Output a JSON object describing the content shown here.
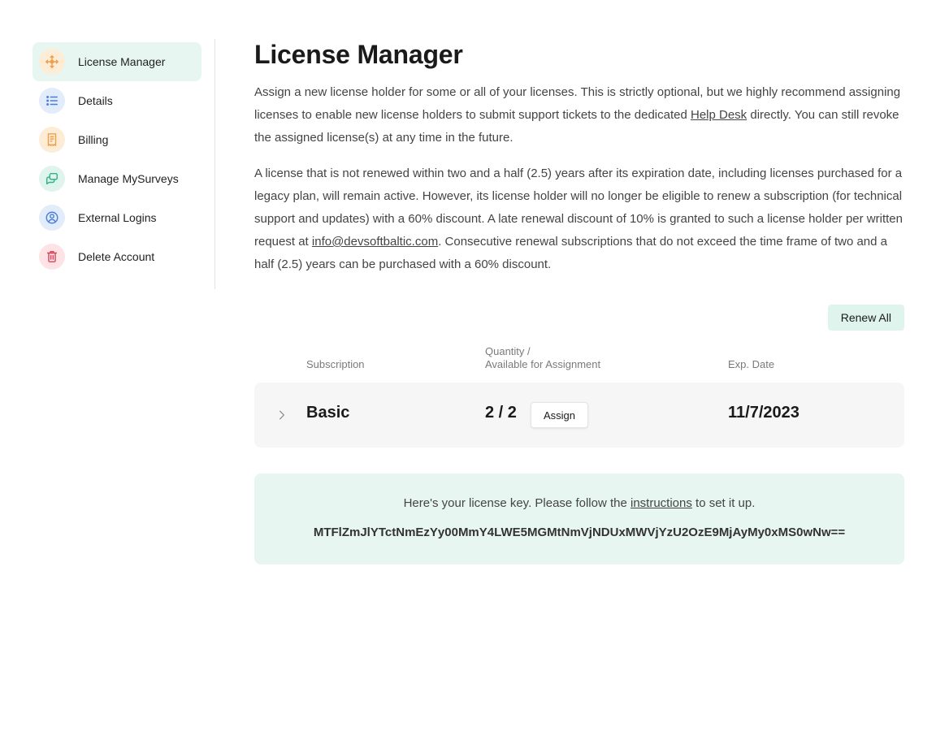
{
  "sidebar": {
    "items": [
      {
        "label": "License Manager",
        "icon": "key-cursor-icon",
        "active": true,
        "icon_bg": "#fdecd6",
        "icon_color": "#f0a04b"
      },
      {
        "label": "Details",
        "icon": "list-icon",
        "active": false,
        "icon_bg": "#e3ecfb",
        "icon_color": "#4a7ee0"
      },
      {
        "label": "Billing",
        "icon": "receipt-icon",
        "active": false,
        "icon_bg": "#fdecd6",
        "icon_color": "#f0a04b"
      },
      {
        "label": "Manage MySurveys",
        "icon": "chat-icon",
        "active": false,
        "icon_bg": "#dff4ec",
        "icon_color": "#2fb38a"
      },
      {
        "label": "External Logins",
        "icon": "user-circle-icon",
        "active": false,
        "icon_bg": "#e3ecfb",
        "icon_color": "#4a7ee0"
      },
      {
        "label": "Delete Account",
        "icon": "trash-icon",
        "active": false,
        "icon_bg": "#fde3e6",
        "icon_color": "#e0435c"
      }
    ]
  },
  "main": {
    "title": "License Manager",
    "para1": {
      "before": "Assign a new license holder for some or all of your licenses. This is strictly optional, but we highly recommend assigning licenses to enable new license holders to submit support tickets to the dedicated ",
      "link": "Help Desk",
      "after": " directly. You can still revoke the assigned license(s) at any time in the future."
    },
    "para2": {
      "before": "A license that is not renewed within two and a half (2.5) years after its expiration date, including licenses purchased for a legacy plan, will remain active. However, its license holder will no longer be eligible to renew a subscription (for technical support and updates) with a 60% discount. A late renewal discount of 10% is granted to such a license holder per written request at ",
      "link": "info@devsoftbaltic.com",
      "after": ". Consecutive renewal subscriptions that do not exceed the time frame of two and a half (2.5) years can be purchased with a 60% discount."
    },
    "renew_all_label": "Renew All",
    "table": {
      "headers": {
        "subscription": "Subscription",
        "quantity_line1": "Quantity /",
        "quantity_line2": "Available for Assignment",
        "exp_date": "Exp. Date"
      },
      "rows": [
        {
          "plan": "Basic",
          "quantity": "2 / 2",
          "assign_label": "Assign",
          "exp_date": "11/7/2023"
        }
      ]
    },
    "license_key": {
      "text_before": "Here's your license key. Please follow the ",
      "link": "instructions",
      "text_after": " to set it up.",
      "key": "MTFlZmJlYTctNmEzYy00MmY4LWE5MGMtNmVjNDUxMWVjYzU2OzE9MjAyMy0xMS0wNw=="
    }
  },
  "colors": {
    "accent_bg": "#e7f6f1",
    "button_bg": "#dff4ec"
  }
}
